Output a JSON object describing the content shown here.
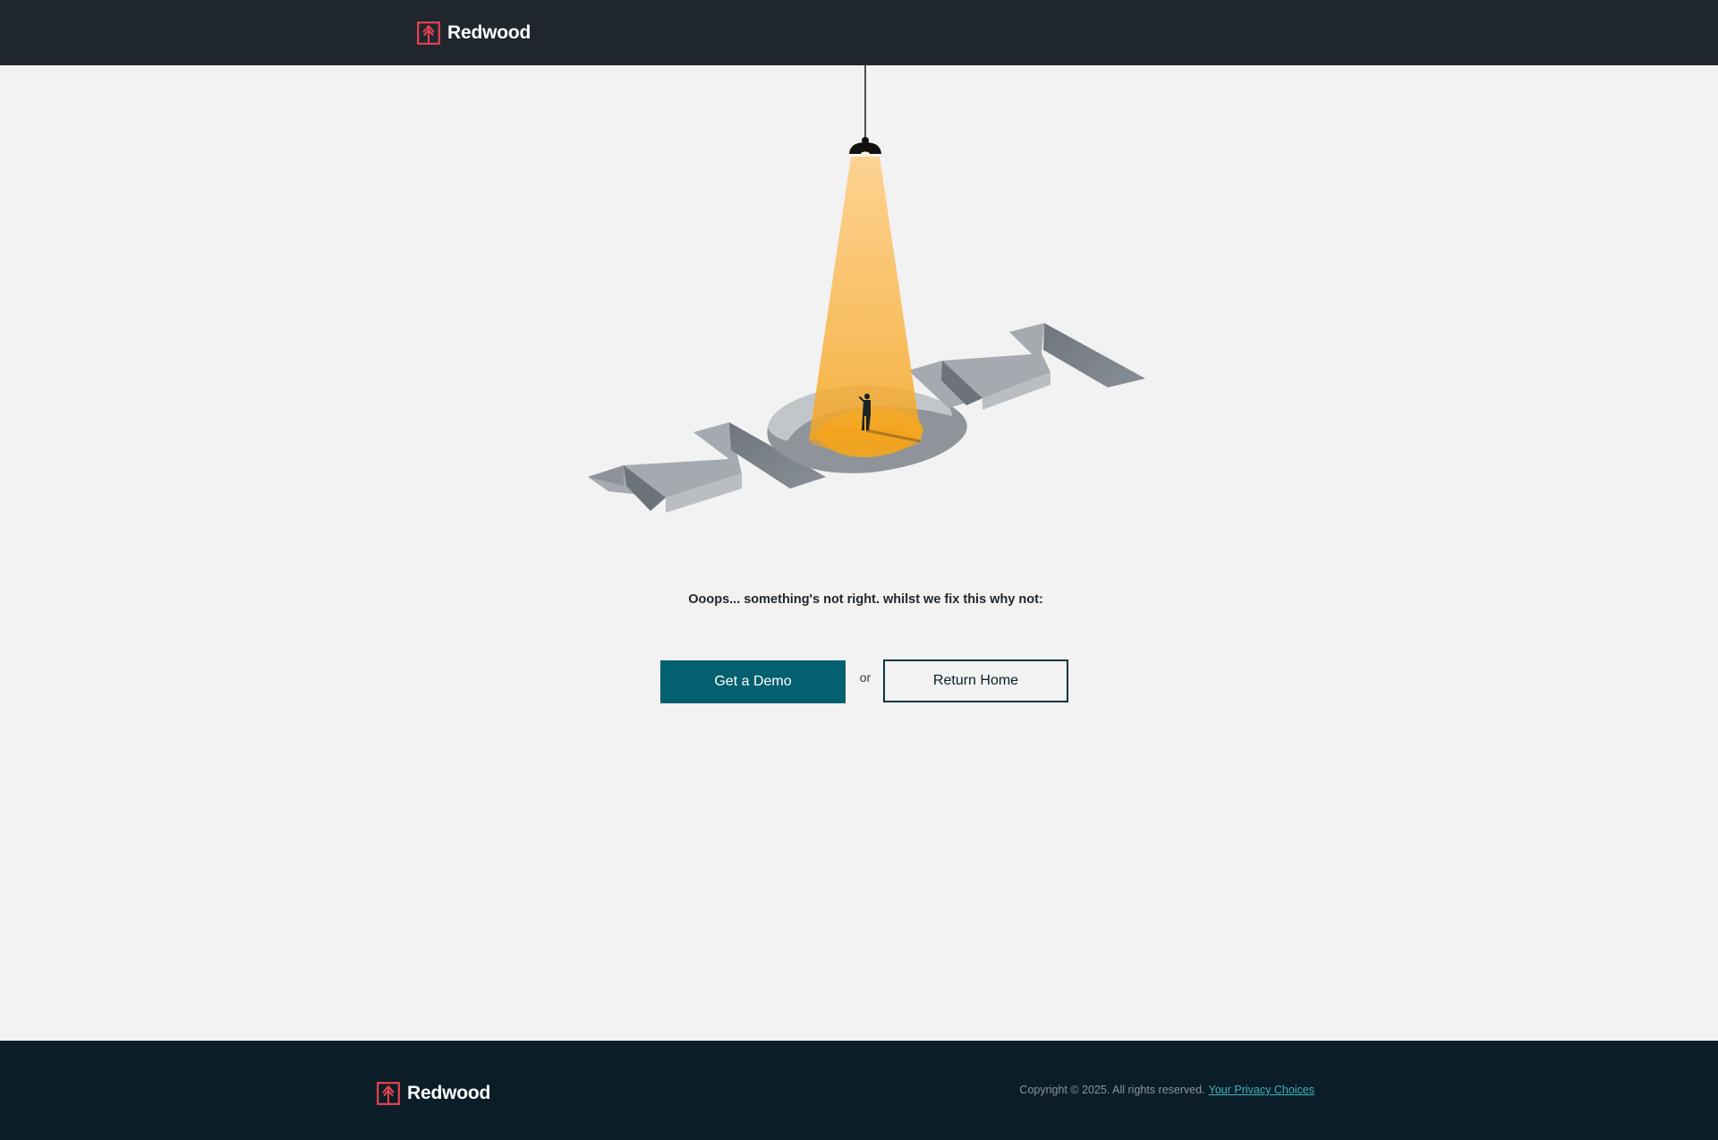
{
  "header": {
    "brand_name": "Redwood"
  },
  "main": {
    "message": "Ooops... something's not right. whilst we fix this why not:",
    "primary_button": "Get a Demo",
    "separator": "or",
    "secondary_button": "Return Home"
  },
  "footer": {
    "brand_name": "Redwood",
    "copyright": "Copyright © 2025. All rights reserved.",
    "privacy_link": "Your Privacy Choices"
  },
  "colors": {
    "header_bg": "#1f262e",
    "page_bg": "#f2f2f2",
    "footer_bg": "#0b1e27",
    "brand_accent": "#e8424f",
    "primary_button": "#03606e",
    "link": "#3fb1c4",
    "spotlight": "#fbb43a"
  },
  "icons": {
    "logo": "redwood-tree-logo-icon"
  }
}
